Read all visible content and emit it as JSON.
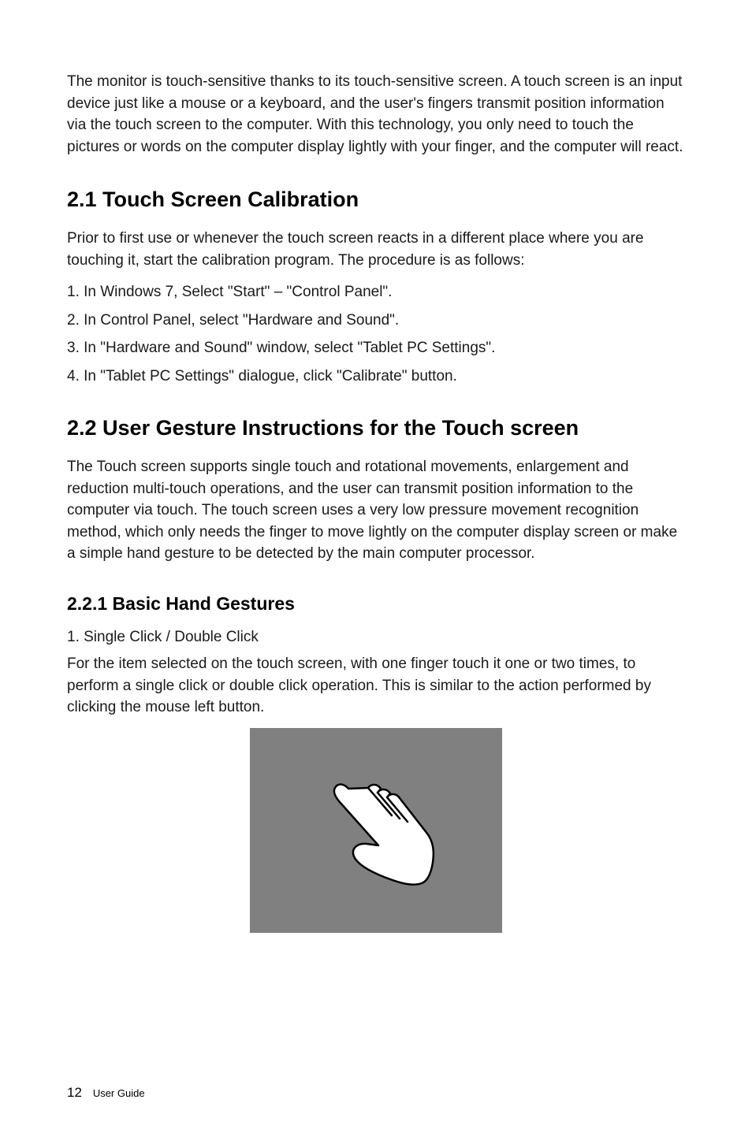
{
  "intro": "The monitor is touch-sensitive thanks to its touch-sensitive screen. A touch screen is an input device just like a mouse or a keyboard, and the user's fingers transmit position information via the touch screen to the computer. With this technology, you only need to touch the pictures or words on the computer display lightly with your finger, and the computer will react.",
  "section21": {
    "heading": "2.1 Touch Screen Calibration",
    "intro": "Prior to first use or whenever the touch screen reacts in a different place where you are touching it, start the calibration program. The procedure is as follows:",
    "steps": [
      "1. In Windows 7, Select \"Start\" – \"Control Panel\".",
      "2. In Control Panel, select \"Hardware and Sound\".",
      "3. In \"Hardware and Sound\" window, select \"Tablet PC Settings\".",
      "4. In \"Tablet PC Settings\" dialogue, click \"Calibrate\" button."
    ]
  },
  "section22": {
    "heading": "2.2 User Gesture Instructions for the Touch screen",
    "intro": "The Touch screen supports single touch and rotational movements, enlargement and reduction multi-touch operations, and the user can transmit position information to the computer via touch. The touch screen uses a very low pressure movement recognition method, which only needs the finger to move lightly on the computer display screen or make a simple hand gesture to be detected by the main computer processor."
  },
  "section221": {
    "heading": "2.2.1 Basic Hand Gestures",
    "item1": "1. Single Click / Double Click",
    "para": "For the item selected on the touch screen, with one finger touch it one or two times, to perform a single click or double click operation. This is similar to the action performed by clicking the mouse left button."
  },
  "footer": {
    "page": "12",
    "label": "User Guide"
  }
}
